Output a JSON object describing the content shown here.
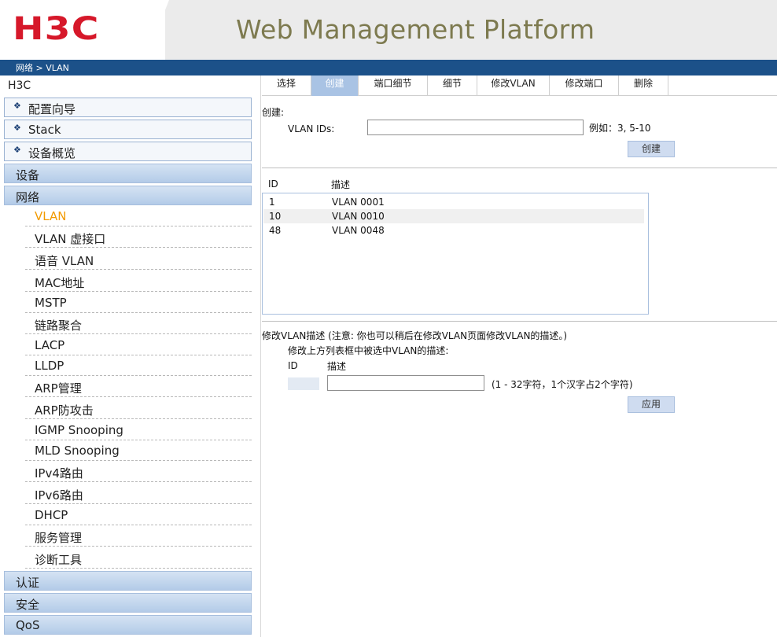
{
  "header": {
    "logo_text": "H3C",
    "title": "Web Management Platform",
    "brand_color": "#d6182a"
  },
  "breadcrumb": "网络 > VLAN",
  "nav": {
    "root": "H3C",
    "boxes": [
      "配置向导",
      "Stack",
      "设备概览"
    ],
    "categories_top": [
      "设备",
      "网络"
    ],
    "network_items": [
      "VLAN",
      "VLAN 虚接口",
      "语音 VLAN",
      "MAC地址",
      "MSTP",
      "链路聚合",
      "LACP",
      "LLDP",
      "ARP管理",
      "ARP防攻击",
      "IGMP Snooping",
      "MLD Snooping",
      "IPv4路由",
      "IPv6路由",
      "DHCP",
      "服务管理",
      "诊断工具"
    ],
    "active_item": "VLAN",
    "categories_bottom": [
      "认证",
      "安全",
      "QoS"
    ]
  },
  "tabs": [
    "选择",
    "创建",
    "端口细节",
    "细节",
    "修改VLAN",
    "修改端口",
    "删除"
  ],
  "selected_tab": "创建",
  "create": {
    "section_label": "创建:",
    "vlan_ids_label": "VLAN IDs:",
    "vlan_ids_value": "",
    "example": "例如：3, 5-10",
    "button": "创建"
  },
  "list": {
    "col_id": "ID",
    "col_desc": "描述",
    "rows": [
      {
        "id": "1",
        "desc": "VLAN 0001"
      },
      {
        "id": "10",
        "desc": "VLAN 0010"
      },
      {
        "id": "48",
        "desc": "VLAN 0048"
      }
    ]
  },
  "modify": {
    "heading": "修改VLAN描述 (注意:  你也可以稍后在修改VLAN页面修改VLAN的描述。)",
    "subheading": "修改上方列表框中被选中VLAN的描述:",
    "col_id": "ID",
    "col_desc": "描述",
    "desc_value": "",
    "hint": "(1 - 32字符，1个汉字占2个字符)",
    "button": "应用"
  }
}
